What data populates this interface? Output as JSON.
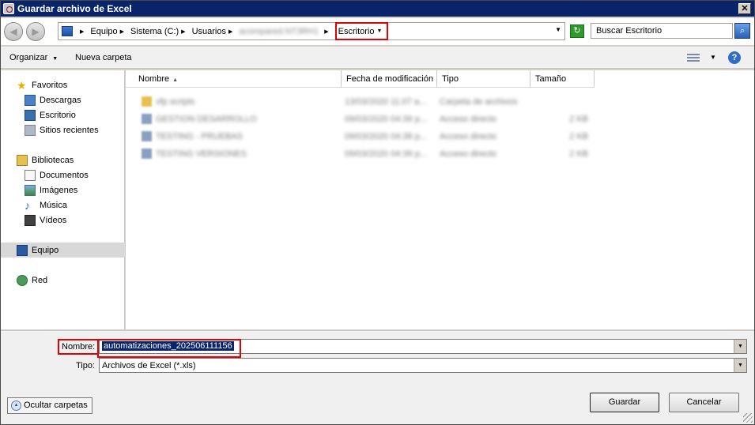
{
  "window": {
    "title": "Guardar archivo de Excel",
    "close_glyph": "✕"
  },
  "address": {
    "crumbs": [
      "Equipo",
      "Sistema (C:)",
      "Usuarios",
      "acompared.NT3RH1",
      "Escritorio"
    ],
    "highlighted_crumb": "Escritorio",
    "search_placeholder": "Buscar Escritorio"
  },
  "toolbar": {
    "organize_label": "Organizar",
    "new_folder_label": "Nueva carpeta",
    "help_glyph": "?"
  },
  "nav": {
    "favorites": {
      "label": "Favoritos",
      "items": [
        "Descargas",
        "Escritorio",
        "Sitios recientes"
      ]
    },
    "libraries": {
      "label": "Bibliotecas",
      "items": [
        "Documentos",
        "Imágenes",
        "Música",
        "Vídeos"
      ]
    },
    "computer": "Equipo",
    "network": "Red"
  },
  "files": {
    "columns": [
      "Nombre",
      "Fecha de modificación",
      "Tipo",
      "Tamaño"
    ],
    "rows": [
      {
        "name": "vfp scripts",
        "date": "13/03/2020 11:07 a...",
        "type": "Carpeta de archivos",
        "size": "",
        "kind": "folder"
      },
      {
        "name": "GESTION DESARROLLO",
        "date": "09/03/2020 04:39 p...",
        "type": "Acceso directo",
        "size": "2 KB",
        "kind": "shortcut"
      },
      {
        "name": "TESTING - PRUEBAS",
        "date": "09/03/2020 04:38 p...",
        "type": "Acceso directo",
        "size": "2 KB",
        "kind": "shortcut"
      },
      {
        "name": "TESTING VERSIONES",
        "date": "09/03/2020 04:39 p...",
        "type": "Acceso directo",
        "size": "2 KB",
        "kind": "shortcut"
      }
    ]
  },
  "form": {
    "name_label": "Nombre:",
    "name_value": "automatizaciones_202506111156",
    "type_label": "Tipo:",
    "type_value": "Archivos de Excel (*.xls)"
  },
  "buttons": {
    "hide_folders": "Ocultar carpetas",
    "save": "Guardar",
    "cancel": "Cancelar"
  },
  "colors": {
    "title_bar": "#0a246a",
    "highlight_border": "#e30000",
    "selection": "#0a246a"
  }
}
